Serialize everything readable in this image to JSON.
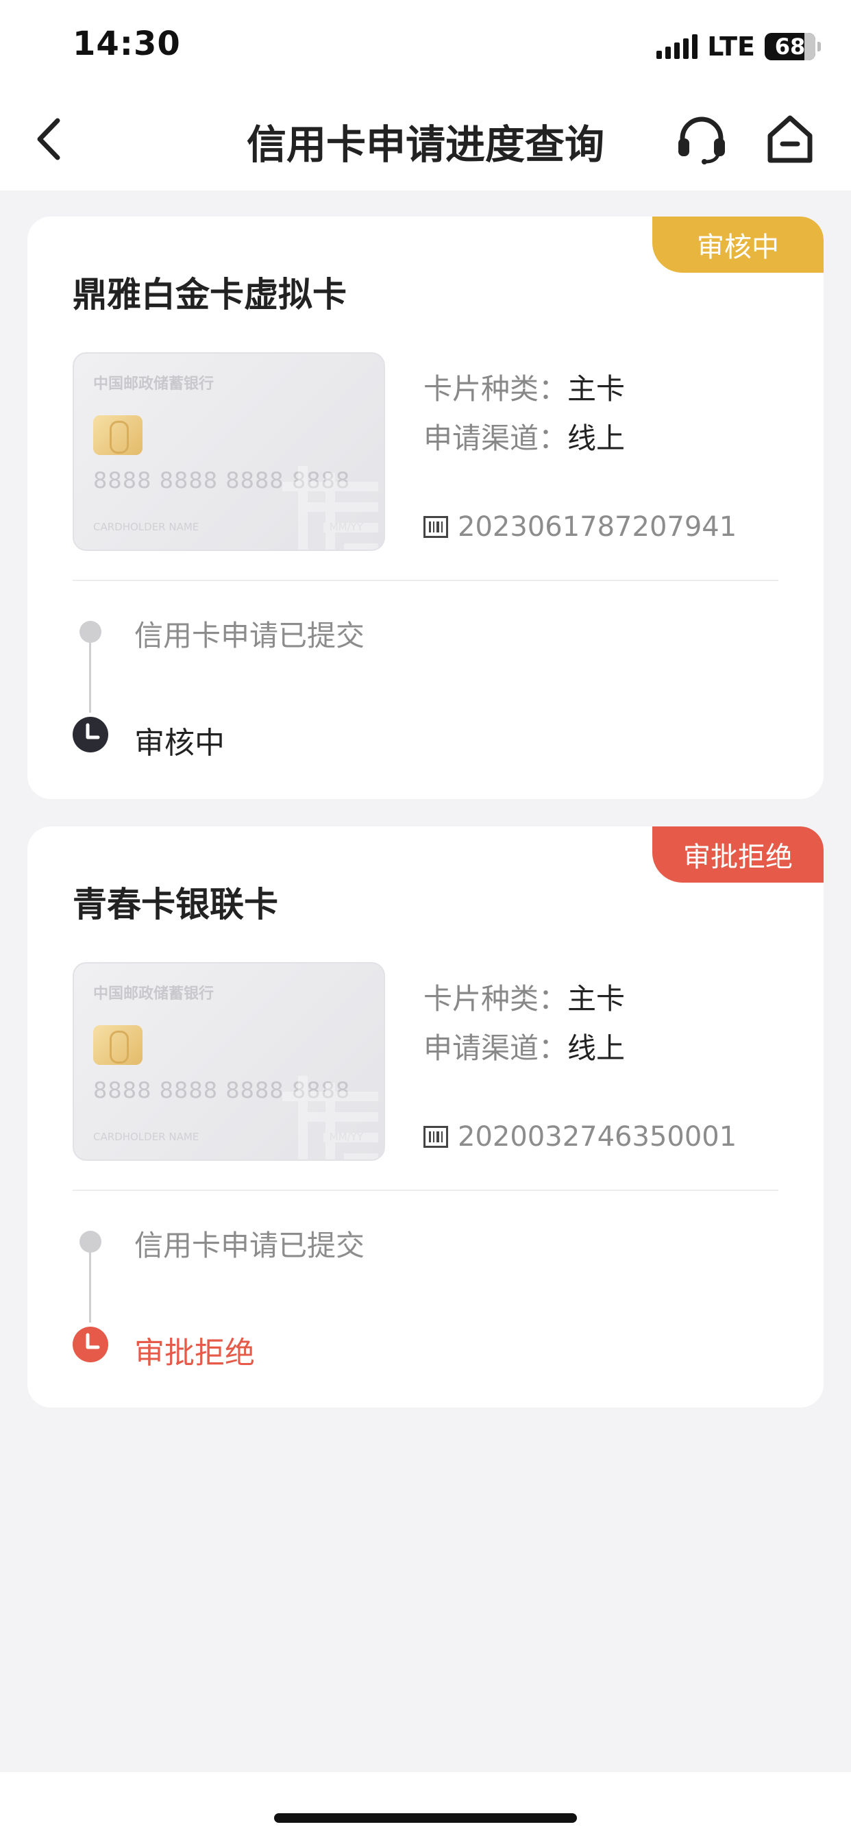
{
  "status_bar": {
    "time": "14:30",
    "network": "LTE",
    "battery": "68"
  },
  "header": {
    "title": "信用卡申请进度查询",
    "icons": [
      "back-icon",
      "headset-icon",
      "home-icon"
    ]
  },
  "applications": [
    {
      "status_badge": "审核中",
      "badge_color": "#e8b63f",
      "card_name": "鼎雅白金卡虚拟卡",
      "card_image": {
        "bank_name": "中国邮政储蓄银行",
        "number": "8888 8888 8888 8888",
        "holder": "CARDHOLDER NAME",
        "expiry": "MM/YY"
      },
      "type_label": "卡片种类：",
      "type_value": "主卡",
      "channel_label": "申请渠道：",
      "channel_value": "线上",
      "application_no": "2023061787207941",
      "timeline": [
        {
          "text": "信用卡申请已提交",
          "state": "done"
        },
        {
          "text": "审核中",
          "state": "current",
          "color": "#2b2b33"
        }
      ]
    },
    {
      "status_badge": "审批拒绝",
      "badge_color": "#e55a48",
      "card_name": "青春卡银联卡",
      "card_image": {
        "bank_name": "中国邮政储蓄银行",
        "number": "8888 8888 8888 8888",
        "holder": "CARDHOLDER NAME",
        "expiry": "MM/YY"
      },
      "type_label": "卡片种类：",
      "type_value": "主卡",
      "channel_label": "申请渠道：",
      "channel_value": "线上",
      "application_no": "2020032746350001",
      "timeline": [
        {
          "text": "信用卡申请已提交",
          "state": "done"
        },
        {
          "text": "审批拒绝",
          "state": "rejected",
          "color": "#e55a48"
        }
      ]
    }
  ]
}
